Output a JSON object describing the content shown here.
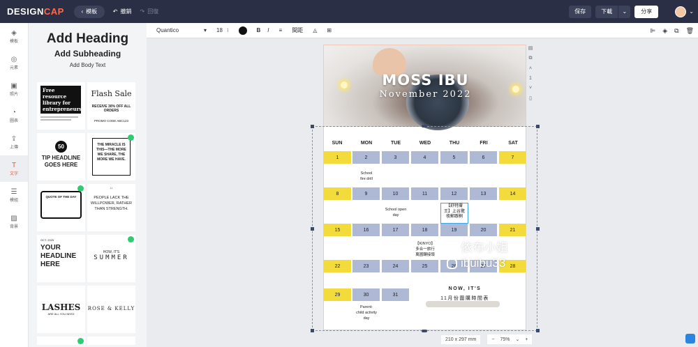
{
  "topbar": {
    "logo_left": "DESIGN",
    "logo_right": "CAP",
    "back_label": "模板",
    "undo_label": "撤銷",
    "redo_label": "回復",
    "save_label": "保存",
    "download_label": "下載",
    "share_label": "分享"
  },
  "left_nav": {
    "items": [
      {
        "label": "模板",
        "icon": "layers-icon"
      },
      {
        "label": "元素",
        "icon": "elements-icon"
      },
      {
        "label": "照片",
        "icon": "photo-icon"
      },
      {
        "label": "圖表",
        "icon": "chart-icon"
      },
      {
        "label": "上傳",
        "icon": "upload-icon"
      },
      {
        "label": "文字",
        "icon": "text-icon"
      },
      {
        "label": "模組",
        "icon": "list-icon"
      },
      {
        "label": "背景",
        "icon": "background-icon"
      }
    ]
  },
  "panel": {
    "heading": "Add Heading",
    "subheading": "Add Subheading",
    "body": "Add Body Text",
    "tiles": [
      {
        "text": "Free resource library for entrepreneurs"
      },
      {
        "text": "Flash Sale",
        "sub": "RECEIVE 30% OFF ALL ORDERS",
        "code": "PROMO CODE ABC123"
      },
      {
        "text": "TIP HEADLINE GOES HERE",
        "num": "50"
      },
      {
        "text": "THE MIRACLE IS THIS—THE MORE WE SHARE, THE MORE WE HAVE."
      },
      {
        "text": "QUOTE OF THE DAY"
      },
      {
        "text": "PEOPLE LACK THE WILLPOWER, RATHER THAN STRENGTH."
      },
      {
        "text": "YOUR HEADLINE HERE",
        "small": "OCT. 2025"
      },
      {
        "text": "SUMMER",
        "small": "HOW, IT'S"
      },
      {
        "text": "LASHES",
        "small": "ARE ALL YOU NEED"
      },
      {
        "text": "ROSE & KELLY"
      }
    ]
  },
  "format_toolbar": {
    "font": "Quantico",
    "size": "18",
    "bold": "B",
    "italic": "I",
    "spacing_label": "間距"
  },
  "page": {
    "title": "MOSS IBU",
    "subtitle": "November 2022",
    "days": [
      "SUN",
      "MON",
      "TUE",
      "WED",
      "THU",
      "FRI",
      "SAT"
    ],
    "notes": {
      "n1": "School\nfire drill",
      "n2": "School open\nday",
      "n3": "【KINYO】\n多合一旅行\n萬國轉接頭",
      "n4": "Parent-\nchild activity\nday",
      "edit": "【舒特膚\n王】上谷驚\n夜郵跟桐"
    },
    "now_its": "NOW, IT'S",
    "now_its_sub": "11月份圍購時間表"
  },
  "watermark": {
    "line1": "依布小姐",
    "line2": "ibuibu33"
  },
  "bottom": {
    "page_size": "210 x 297 mm",
    "zoom": "75%",
    "minus": "−",
    "plus": "+"
  }
}
